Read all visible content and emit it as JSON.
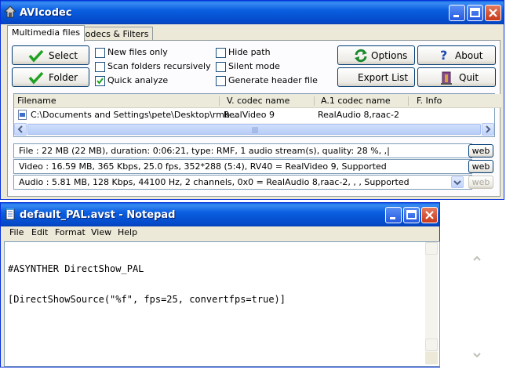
{
  "avicodec": {
    "title": "AVIcodec",
    "tabs": [
      "Multimedia files",
      "Codecs & Filters"
    ],
    "buttons": {
      "select": "Select",
      "folder": "Folder",
      "options": "Options",
      "about": "About",
      "export": "Export List",
      "quit": "Quit"
    },
    "checkboxes": [
      {
        "label": "New files only",
        "checked": false
      },
      {
        "label": "Scan folders recursively",
        "checked": false
      },
      {
        "label": "Quick analyze",
        "checked": true
      },
      {
        "label": "Hide path",
        "checked": false
      },
      {
        "label": "Silent mode",
        "checked": false
      },
      {
        "label": "Generate header file",
        "checked": false
      }
    ],
    "columns": [
      "Filename",
      "V. codec name",
      "A.1 codec name",
      "F. Info"
    ],
    "rows": [
      {
        "filename": "C:\\Documents and Settings\\pete\\Desktop\\rmb...",
        "vcodec": "RealVideo 9",
        "acodec": "RealAudio 8,raac-2",
        "finfo": ""
      }
    ],
    "info": {
      "file": "File    :  22 MB (22 MB),  duration: 0:06:21,  type: RMF,  1 audio stream(s),  quality: 28 %, ,|",
      "video": "Video :  16.59 MB,  365 Kbps,  25.0 fps,  352*288 (5:4),  RV40 = RealVideo 9,    Supported",
      "audio": "Audio :  5.81 MB,  128 Kbps,  44100 Hz,  2 channels,  0x0 = RealAudio 8,raac-2,  , ,   Supported"
    },
    "web_label": "web"
  },
  "notepad": {
    "title": "default_PAL.avst - Notepad",
    "menu": [
      "File",
      "Edit",
      "Format",
      "View",
      "Help"
    ],
    "lines": [
      "#ASYNTHER DirectShow_PAL",
      "[DirectShowSource(\"%f\", fps=25, convertfps=true)]"
    ]
  },
  "colors": {
    "titlebar": "#0a5fe0",
    "window": "#ece9d8",
    "close": "#c8381a",
    "check": "#21a121"
  }
}
